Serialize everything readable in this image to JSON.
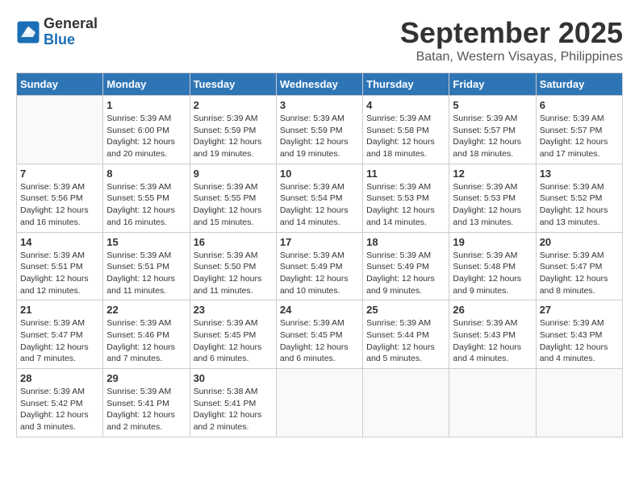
{
  "header": {
    "logo": {
      "general": "General",
      "blue": "Blue"
    },
    "title": "September 2025",
    "subtitle": "Batan, Western Visayas, Philippines"
  },
  "weekdays": [
    "Sunday",
    "Monday",
    "Tuesday",
    "Wednesday",
    "Thursday",
    "Friday",
    "Saturday"
  ],
  "weeks": [
    [
      {
        "day": "",
        "info": ""
      },
      {
        "day": "1",
        "info": "Sunrise: 5:39 AM\nSunset: 6:00 PM\nDaylight: 12 hours\nand 20 minutes."
      },
      {
        "day": "2",
        "info": "Sunrise: 5:39 AM\nSunset: 5:59 PM\nDaylight: 12 hours\nand 19 minutes."
      },
      {
        "day": "3",
        "info": "Sunrise: 5:39 AM\nSunset: 5:59 PM\nDaylight: 12 hours\nand 19 minutes."
      },
      {
        "day": "4",
        "info": "Sunrise: 5:39 AM\nSunset: 5:58 PM\nDaylight: 12 hours\nand 18 minutes."
      },
      {
        "day": "5",
        "info": "Sunrise: 5:39 AM\nSunset: 5:57 PM\nDaylight: 12 hours\nand 18 minutes."
      },
      {
        "day": "6",
        "info": "Sunrise: 5:39 AM\nSunset: 5:57 PM\nDaylight: 12 hours\nand 17 minutes."
      }
    ],
    [
      {
        "day": "7",
        "info": "Sunrise: 5:39 AM\nSunset: 5:56 PM\nDaylight: 12 hours\nand 16 minutes."
      },
      {
        "day": "8",
        "info": "Sunrise: 5:39 AM\nSunset: 5:55 PM\nDaylight: 12 hours\nand 16 minutes."
      },
      {
        "day": "9",
        "info": "Sunrise: 5:39 AM\nSunset: 5:55 PM\nDaylight: 12 hours\nand 15 minutes."
      },
      {
        "day": "10",
        "info": "Sunrise: 5:39 AM\nSunset: 5:54 PM\nDaylight: 12 hours\nand 14 minutes."
      },
      {
        "day": "11",
        "info": "Sunrise: 5:39 AM\nSunset: 5:53 PM\nDaylight: 12 hours\nand 14 minutes."
      },
      {
        "day": "12",
        "info": "Sunrise: 5:39 AM\nSunset: 5:53 PM\nDaylight: 12 hours\nand 13 minutes."
      },
      {
        "day": "13",
        "info": "Sunrise: 5:39 AM\nSunset: 5:52 PM\nDaylight: 12 hours\nand 13 minutes."
      }
    ],
    [
      {
        "day": "14",
        "info": "Sunrise: 5:39 AM\nSunset: 5:51 PM\nDaylight: 12 hours\nand 12 minutes."
      },
      {
        "day": "15",
        "info": "Sunrise: 5:39 AM\nSunset: 5:51 PM\nDaylight: 12 hours\nand 11 minutes."
      },
      {
        "day": "16",
        "info": "Sunrise: 5:39 AM\nSunset: 5:50 PM\nDaylight: 12 hours\nand 11 minutes."
      },
      {
        "day": "17",
        "info": "Sunrise: 5:39 AM\nSunset: 5:49 PM\nDaylight: 12 hours\nand 10 minutes."
      },
      {
        "day": "18",
        "info": "Sunrise: 5:39 AM\nSunset: 5:49 PM\nDaylight: 12 hours\nand 9 minutes."
      },
      {
        "day": "19",
        "info": "Sunrise: 5:39 AM\nSunset: 5:48 PM\nDaylight: 12 hours\nand 9 minutes."
      },
      {
        "day": "20",
        "info": "Sunrise: 5:39 AM\nSunset: 5:47 PM\nDaylight: 12 hours\nand 8 minutes."
      }
    ],
    [
      {
        "day": "21",
        "info": "Sunrise: 5:39 AM\nSunset: 5:47 PM\nDaylight: 12 hours\nand 7 minutes."
      },
      {
        "day": "22",
        "info": "Sunrise: 5:39 AM\nSunset: 5:46 PM\nDaylight: 12 hours\nand 7 minutes."
      },
      {
        "day": "23",
        "info": "Sunrise: 5:39 AM\nSunset: 5:45 PM\nDaylight: 12 hours\nand 6 minutes."
      },
      {
        "day": "24",
        "info": "Sunrise: 5:39 AM\nSunset: 5:45 PM\nDaylight: 12 hours\nand 6 minutes."
      },
      {
        "day": "25",
        "info": "Sunrise: 5:39 AM\nSunset: 5:44 PM\nDaylight: 12 hours\nand 5 minutes."
      },
      {
        "day": "26",
        "info": "Sunrise: 5:39 AM\nSunset: 5:43 PM\nDaylight: 12 hours\nand 4 minutes."
      },
      {
        "day": "27",
        "info": "Sunrise: 5:39 AM\nSunset: 5:43 PM\nDaylight: 12 hours\nand 4 minutes."
      }
    ],
    [
      {
        "day": "28",
        "info": "Sunrise: 5:39 AM\nSunset: 5:42 PM\nDaylight: 12 hours\nand 3 minutes."
      },
      {
        "day": "29",
        "info": "Sunrise: 5:39 AM\nSunset: 5:41 PM\nDaylight: 12 hours\nand 2 minutes."
      },
      {
        "day": "30",
        "info": "Sunrise: 5:38 AM\nSunset: 5:41 PM\nDaylight: 12 hours\nand 2 minutes."
      },
      {
        "day": "",
        "info": ""
      },
      {
        "day": "",
        "info": ""
      },
      {
        "day": "",
        "info": ""
      },
      {
        "day": "",
        "info": ""
      }
    ]
  ]
}
